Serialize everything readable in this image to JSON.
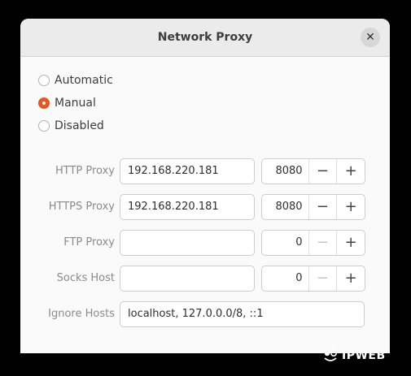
{
  "dialog": {
    "title": "Network Proxy",
    "close_icon": "close-icon"
  },
  "modes": [
    {
      "label": "Automatic",
      "selected": false
    },
    {
      "label": "Manual",
      "selected": true
    },
    {
      "label": "Disabled",
      "selected": false
    }
  ],
  "proxies": {
    "http": {
      "label": "HTTP Proxy",
      "host": "192.168.220.181",
      "port": "8080",
      "decrement": "−",
      "increment": "+"
    },
    "https": {
      "label": "HTTPS Proxy",
      "host": "192.168.220.181",
      "port": "8080",
      "decrement": "−",
      "increment": "+"
    },
    "ftp": {
      "label": "FTP Proxy",
      "host": "",
      "port": "0",
      "decrement": "−",
      "increment": "+"
    },
    "socks": {
      "label": "Socks Host",
      "host": "",
      "port": "0",
      "decrement": "−",
      "increment": "+"
    }
  },
  "ignore_hosts": {
    "label": "Ignore Hosts",
    "value": "localhost, 127.0.0.0/8, ::1"
  },
  "colors": {
    "accent": "#e95420"
  },
  "watermark": {
    "text": "IPWEB"
  }
}
